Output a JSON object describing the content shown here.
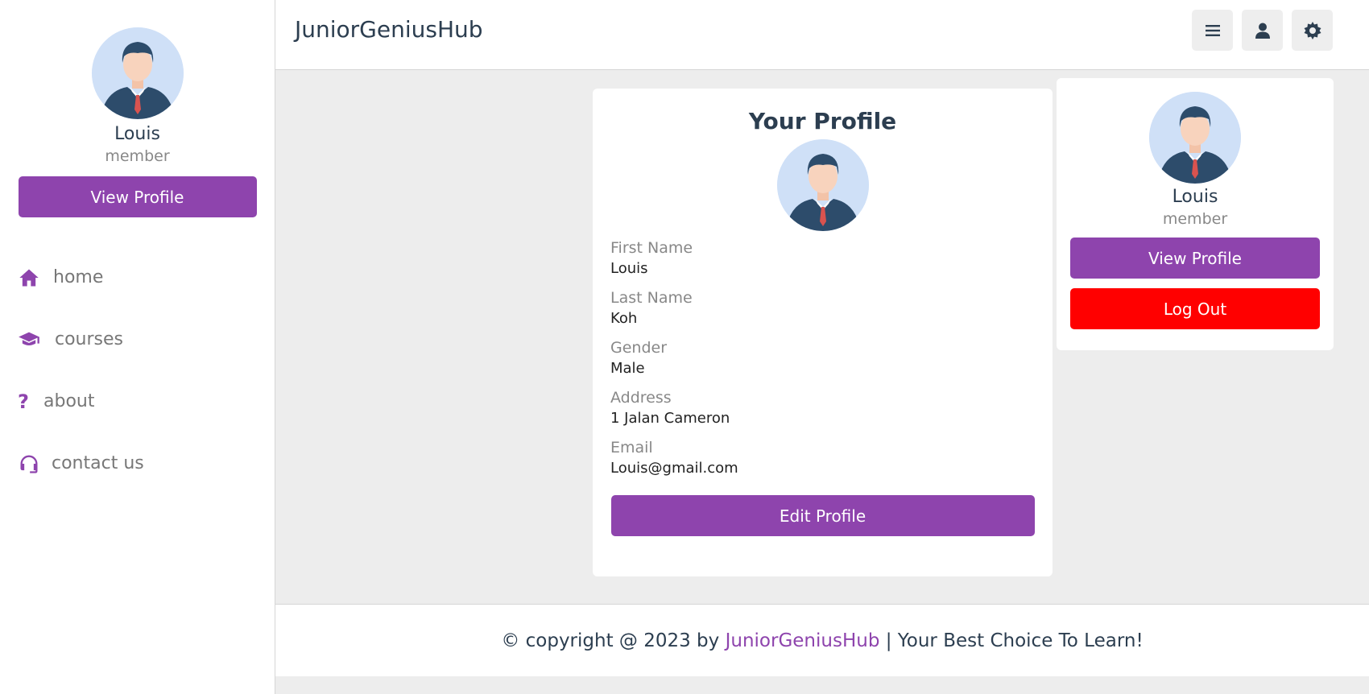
{
  "app": {
    "title": "JuniorGeniusHub"
  },
  "colors": {
    "accent": "#8e44ad",
    "danger": "#ff0000",
    "background": "#ededed"
  },
  "header": {
    "buttons": [
      {
        "icon": "menu-icon"
      },
      {
        "icon": "user-icon"
      },
      {
        "icon": "settings-icon"
      }
    ]
  },
  "sidebar": {
    "user": {
      "name": "Louis",
      "role": "member"
    },
    "view_profile_label": "View Profile",
    "nav": [
      {
        "label": "home",
        "icon": "home-icon"
      },
      {
        "label": "courses",
        "icon": "graduation-cap-icon"
      },
      {
        "label": "about",
        "icon": "question-icon"
      },
      {
        "label": "contact us",
        "icon": "headset-icon"
      }
    ]
  },
  "profile": {
    "title": "Your Profile",
    "fields": [
      {
        "label": "First Name",
        "value": "Louis"
      },
      {
        "label": "Last Name",
        "value": "Koh"
      },
      {
        "label": "Gender",
        "value": "Male"
      },
      {
        "label": "Address",
        "value": "1 Jalan Cameron"
      },
      {
        "label": "Email",
        "value": "Louis@gmail.com"
      }
    ],
    "edit_label": "Edit Profile"
  },
  "account_widget": {
    "name": "Louis",
    "role": "member",
    "view_profile_label": "View Profile",
    "logout_label": "Log Out"
  },
  "footer": {
    "prefix": "© copyright @ 2023 by ",
    "brand": "JuniorGeniusHub",
    "suffix": " | Your Best Choice To Learn!"
  }
}
